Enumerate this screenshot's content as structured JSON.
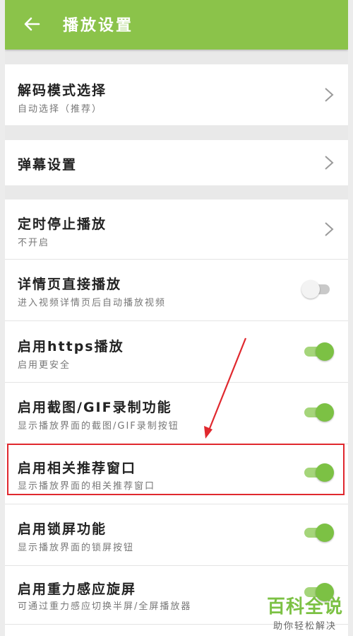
{
  "appbar": {
    "title": "播放设置",
    "back_icon": "arrow-left-icon"
  },
  "items": [
    {
      "title": "解码模式选择",
      "subtitle": "自动选择（推荐）",
      "control": "chevron"
    },
    {
      "title": "弹幕设置",
      "subtitle": "",
      "control": "chevron"
    },
    {
      "title": "定时停止播放",
      "subtitle": "不开启",
      "control": "chevron"
    },
    {
      "title": "详情页直接播放",
      "subtitle": "进入视频详情页后自动播放视频",
      "control": "toggle",
      "enabled": false
    },
    {
      "title": "启用https播放",
      "subtitle": "启用更安全",
      "control": "toggle",
      "enabled": true
    },
    {
      "title": "启用截图/GIF录制功能",
      "subtitle": "显示播放界面的截图/GIF录制按钮",
      "control": "toggle",
      "enabled": true
    },
    {
      "title": "启用相关推荐窗口",
      "subtitle": "显示播放界面的相关推荐窗口",
      "control": "toggle",
      "enabled": true
    },
    {
      "title": "启用锁屏功能",
      "subtitle": "显示播放界面的锁屏按钮",
      "control": "toggle",
      "enabled": true
    },
    {
      "title": "启用重力感应旋屏",
      "subtitle": "可通过重力感应切换半屏/全屏播放器",
      "control": "toggle",
      "enabled": true
    }
  ],
  "watermark": {
    "main": "百科全说",
    "sub": "助你轻松解决"
  },
  "colors": {
    "accent": "#8bc34a",
    "toggle_on": "#7cc144",
    "highlight": "#e0282e"
  }
}
